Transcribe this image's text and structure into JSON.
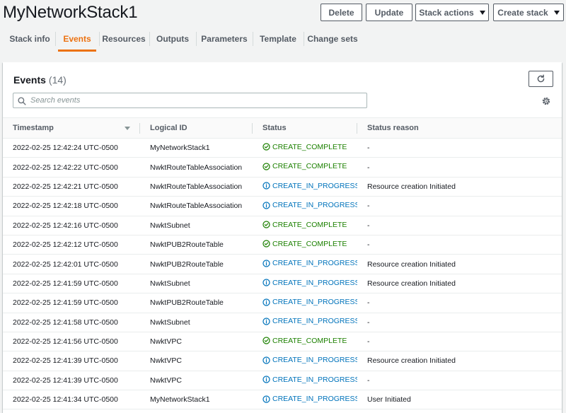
{
  "page": {
    "title": "MyNetworkStack1"
  },
  "actions": {
    "delete": "Delete",
    "update": "Update",
    "stack_actions": "Stack actions",
    "create_stack": "Create stack"
  },
  "tabs": [
    {
      "label": "Stack info",
      "active": false
    },
    {
      "label": "Events",
      "active": true
    },
    {
      "label": "Resources",
      "active": false
    },
    {
      "label": "Outputs",
      "active": false
    },
    {
      "label": "Parameters",
      "active": false
    },
    {
      "label": "Template",
      "active": false
    },
    {
      "label": "Change sets",
      "active": false
    }
  ],
  "events": {
    "title": "Events",
    "count": "(14)",
    "search_placeholder": "Search events",
    "columns": [
      "Timestamp",
      "Logical ID",
      "Status",
      "Status reason"
    ],
    "rows": [
      {
        "timestamp": "2022-02-25 12:42:24 UTC-0500",
        "logical_id": "MyNetworkStack1",
        "status": "CREATE_COMPLETE",
        "kind": "complete",
        "reason": "-"
      },
      {
        "timestamp": "2022-02-25 12:42:22 UTC-0500",
        "logical_id": "NwktRouteTableAssociation",
        "status": "CREATE_COMPLETE",
        "kind": "complete",
        "reason": "-"
      },
      {
        "timestamp": "2022-02-25 12:42:21 UTC-0500",
        "logical_id": "NwktRouteTableAssociation",
        "status": "CREATE_IN_PROGRESS",
        "kind": "progress",
        "reason": "Resource creation Initiated"
      },
      {
        "timestamp": "2022-02-25 12:42:18 UTC-0500",
        "logical_id": "NwktRouteTableAssociation",
        "status": "CREATE_IN_PROGRESS",
        "kind": "progress",
        "reason": "-"
      },
      {
        "timestamp": "2022-02-25 12:42:16 UTC-0500",
        "logical_id": "NwktSubnet",
        "status": "CREATE_COMPLETE",
        "kind": "complete",
        "reason": "-"
      },
      {
        "timestamp": "2022-02-25 12:42:12 UTC-0500",
        "logical_id": "NwktPUB2RouteTable",
        "status": "CREATE_COMPLETE",
        "kind": "complete",
        "reason": "-"
      },
      {
        "timestamp": "2022-02-25 12:42:01 UTC-0500",
        "logical_id": "NwktPUB2RouteTable",
        "status": "CREATE_IN_PROGRESS",
        "kind": "progress",
        "reason": "Resource creation Initiated"
      },
      {
        "timestamp": "2022-02-25 12:41:59 UTC-0500",
        "logical_id": "NwktSubnet",
        "status": "CREATE_IN_PROGRESS",
        "kind": "progress",
        "reason": "Resource creation Initiated"
      },
      {
        "timestamp": "2022-02-25 12:41:59 UTC-0500",
        "logical_id": "NwktPUB2RouteTable",
        "status": "CREATE_IN_PROGRESS",
        "kind": "progress",
        "reason": "-"
      },
      {
        "timestamp": "2022-02-25 12:41:58 UTC-0500",
        "logical_id": "NwktSubnet",
        "status": "CREATE_IN_PROGRESS",
        "kind": "progress",
        "reason": "-"
      },
      {
        "timestamp": "2022-02-25 12:41:56 UTC-0500",
        "logical_id": "NwktVPC",
        "status": "CREATE_COMPLETE",
        "kind": "complete",
        "reason": "-"
      },
      {
        "timestamp": "2022-02-25 12:41:39 UTC-0500",
        "logical_id": "NwktVPC",
        "status": "CREATE_IN_PROGRESS",
        "kind": "progress",
        "reason": "Resource creation Initiated"
      },
      {
        "timestamp": "2022-02-25 12:41:39 UTC-0500",
        "logical_id": "NwktVPC",
        "status": "CREATE_IN_PROGRESS",
        "kind": "progress",
        "reason": "-"
      },
      {
        "timestamp": "2022-02-25 12:41:34 UTC-0500",
        "logical_id": "MyNetworkStack1",
        "status": "CREATE_IN_PROGRESS",
        "kind": "progress",
        "reason": "User Initiated"
      }
    ]
  },
  "colors": {
    "accent": "#ec7211",
    "complete": "#1d8102",
    "in_progress": "#0073bb"
  },
  "icons": {
    "refresh": "refresh-icon",
    "search": "search-icon",
    "settings": "gear-icon",
    "complete": "check-circle-icon",
    "in_progress": "info-circle-icon",
    "sort": "sort-caret-icon",
    "dropdown": "caret-down-icon"
  }
}
